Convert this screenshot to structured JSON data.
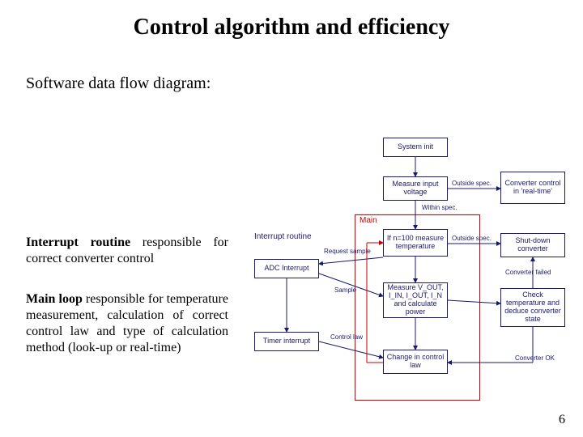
{
  "title": "Control algorithm and efficiency",
  "subtitle": "Software data flow diagram:",
  "para1_pre": "Interrupt routine",
  "para1_rest": " responsible for correct converter control",
  "para2_pre": "Main loop",
  "para2_rest": " responsible for temperature measurement, calculation of correct control law and type of calculation method (look-up or real-time)",
  "page_number": "6",
  "diagram": {
    "main_label": "Main",
    "interrupt_label": "Interrupt routine",
    "col_main": {
      "b1": "System init",
      "b2": "Measure input voltage",
      "b3": "If n=100 measure temperature",
      "b4": "Measure V_OUT, I_IN, I_OUT, I_N and calculate power",
      "b5": "Change in control law"
    },
    "col_interrupt": {
      "b1": "ADC Interrupt",
      "b2": "Timer interrupt"
    },
    "col_right": {
      "b1": "Converter control in 'real-time'",
      "b2": "Shut-down converter",
      "b3": "Check temperature and deduce converter state"
    },
    "edges": {
      "outside_spec1": "Outside spec.",
      "within_spec": "Within spec.",
      "outside_spec2": "Outside spec.",
      "request_sample": "Request sample",
      "sample": "Sample",
      "control_law": "Control law",
      "converter_failed": "Converter failed",
      "converter_ok": "Converter OK"
    }
  }
}
